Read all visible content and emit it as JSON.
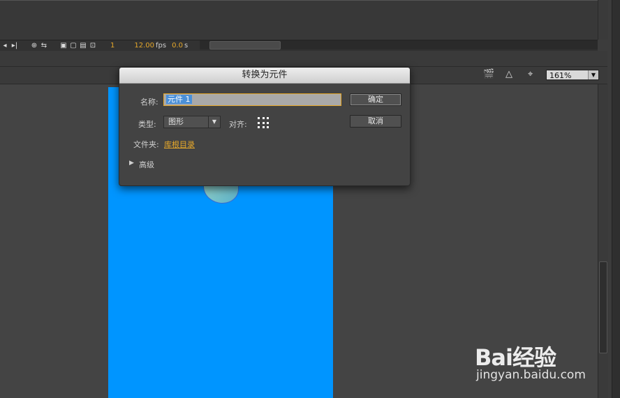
{
  "timeline": {
    "frame": "1",
    "fps_value": "12.00",
    "fps_unit": "fps",
    "time_value": "0.0",
    "time_unit": "s"
  },
  "stage": {
    "zoom": "161%"
  },
  "dialog": {
    "title": "转换为元件",
    "name_label": "名称:",
    "name_value": "元件 1",
    "type_label": "类型:",
    "type_value": "图形",
    "align_label": "对齐:",
    "folder_label": "文件夹:",
    "folder_value": "库根目录",
    "advanced_label": "高级",
    "ok_label": "确定",
    "cancel_label": "取消"
  },
  "watermark": {
    "brand": "Bai经验",
    "url": "jingyan.baidu.com"
  }
}
